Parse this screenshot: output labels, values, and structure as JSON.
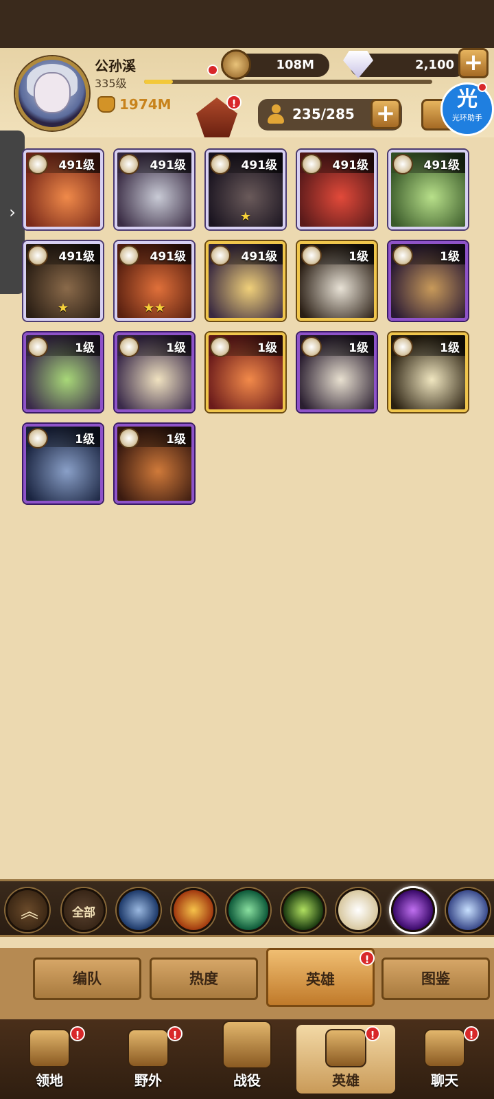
{
  "player": {
    "name": "公孙溪",
    "level": "335级",
    "power": "1974M",
    "xp_fraction": 0.1
  },
  "currency": {
    "gold": "108M",
    "gems": "2,100",
    "heroes": "235/285"
  },
  "helper": {
    "logo": "光",
    "label": "光环助手"
  },
  "badges": {
    "formation": "!",
    "tab_heroes": "!",
    "nav_territory": "!",
    "nav_wild": "!",
    "nav_heroes": "!",
    "nav_chat": "!"
  },
  "side_tab_arrow": "›",
  "heroes": [
    {
      "level": "491级",
      "stars": "",
      "frame": "silver",
      "colors": [
        "#f08a4a",
        "#7a2a1a"
      ]
    },
    {
      "level": "491级",
      "stars": "",
      "frame": "silver",
      "colors": [
        "#c9cbd6",
        "#3a2c44"
      ]
    },
    {
      "level": "491级",
      "stars": "★",
      "frame": "silver",
      "colors": [
        "#6a5a5a",
        "#1a1420"
      ]
    },
    {
      "level": "491级",
      "stars": "",
      "frame": "silver",
      "colors": [
        "#e24a3a",
        "#5a1a1a"
      ]
    },
    {
      "level": "491级",
      "stars": "",
      "frame": "silver",
      "colors": [
        "#b8e08a",
        "#3a5a2a"
      ]
    },
    {
      "level": "491级",
      "stars": "★",
      "frame": "silver",
      "colors": [
        "#8a6a4a",
        "#2a1e14"
      ]
    },
    {
      "level": "491级",
      "stars": "★★",
      "frame": "silver",
      "colors": [
        "#e0703a",
        "#5a2010"
      ]
    },
    {
      "level": "491级",
      "stars": "",
      "frame": "gold",
      "colors": [
        "#f0d07a",
        "#3a2a40"
      ]
    },
    {
      "level": "1级",
      "stars": "",
      "frame": "gold",
      "colors": [
        "#e8e2d6",
        "#2a1e14"
      ]
    },
    {
      "level": "1级",
      "stars": "",
      "frame": "violet",
      "colors": [
        "#c89a5a",
        "#2a1a34"
      ]
    },
    {
      "level": "1级",
      "stars": "",
      "frame": "violet",
      "colors": [
        "#a8d878",
        "#3a2a4a"
      ]
    },
    {
      "level": "1级",
      "stars": "",
      "frame": "violet",
      "colors": [
        "#f0e2c0",
        "#3a2a4a"
      ]
    },
    {
      "level": "1级",
      "stars": "",
      "frame": "gold",
      "colors": [
        "#f28a4a",
        "#6a1a1a"
      ]
    },
    {
      "level": "1级",
      "stars": "",
      "frame": "violet",
      "colors": [
        "#e8e0d0",
        "#2a1e30"
      ]
    },
    {
      "level": "1级",
      "stars": "",
      "frame": "gold",
      "colors": [
        "#f0e6c0",
        "#2a2010"
      ]
    },
    {
      "level": "1级",
      "stars": "",
      "frame": "violet",
      "colors": [
        "#8aa0c8",
        "#1a2440"
      ]
    },
    {
      "level": "1级",
      "stars": "",
      "frame": "violet",
      "colors": [
        "#d07a3a",
        "#3a1a10"
      ]
    }
  ],
  "faction_filter": {
    "collapse_icon": "︽",
    "all_label": "全部",
    "factions": [
      {
        "name": "lightbearer-icon",
        "color_a": "#9ab8e0",
        "color_b": "#1e3a6a"
      },
      {
        "name": "mauler-icon",
        "color_a": "#f6c24a",
        "color_b": "#a23a10"
      },
      {
        "name": "wilder-icon",
        "color_a": "#8ae0a0",
        "color_b": "#0e5a3a"
      },
      {
        "name": "graveborn-icon",
        "color_a": "#b0e060",
        "color_b": "#1a3a10"
      },
      {
        "name": "celestial-icon",
        "color_a": "#ffffff",
        "color_b": "#d8c8a0"
      },
      {
        "name": "hypogean-icon",
        "color_a": "#c070f0",
        "color_b": "#3a0a6a"
      },
      {
        "name": "dimensional-icon",
        "color_a": "#c8e0ff",
        "color_b": "#3a4a8a"
      }
    ],
    "selected_index": 5
  },
  "sub_tabs": {
    "formation": "编队",
    "popularity": "热度",
    "heroes": "英雄",
    "codex": "图鉴"
  },
  "nav": {
    "territory": "领地",
    "wild": "野外",
    "campaign": "战役",
    "heroes": "英雄",
    "chat": "聊天"
  }
}
